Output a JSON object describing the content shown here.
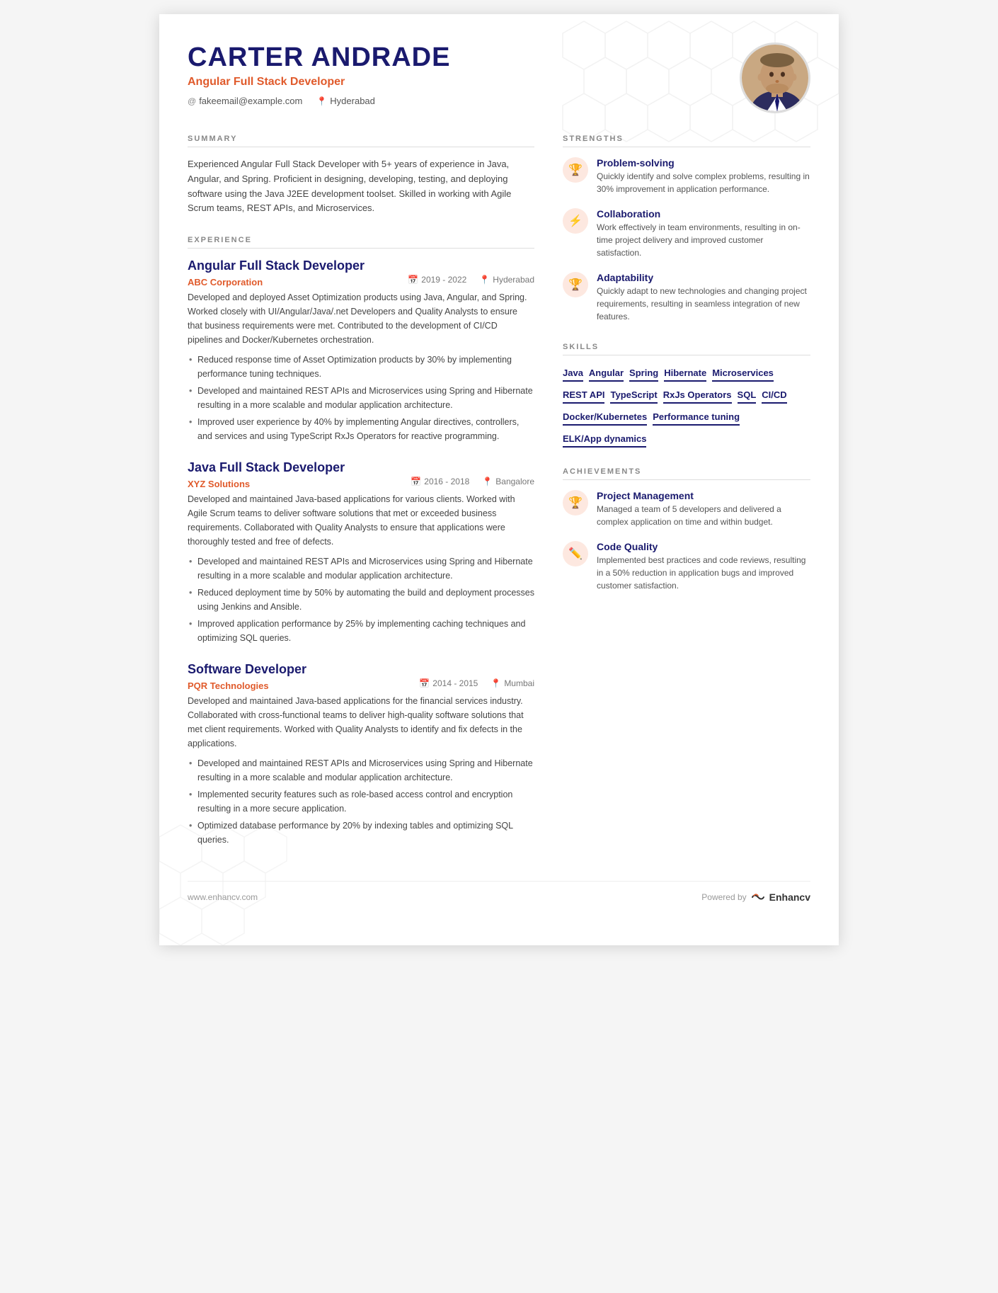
{
  "header": {
    "name": "CARTER ANDRADE",
    "title": "Angular Full Stack Developer",
    "email": "fakeemail@example.com",
    "location": "Hyderabad"
  },
  "summary": {
    "label": "SUMMARY",
    "text": "Experienced Angular Full Stack Developer with 5+ years of experience in Java, Angular, and Spring. Proficient in designing, developing, testing, and deploying software using the Java J2EE development toolset. Skilled in working with Agile Scrum teams, REST APIs, and Microservices."
  },
  "experience": {
    "label": "EXPERIENCE",
    "jobs": [
      {
        "title": "Angular Full Stack Developer",
        "company": "ABC Corporation",
        "period": "2019 - 2022",
        "location": "Hyderabad",
        "description": "Developed and deployed Asset Optimization products using Java, Angular, and Spring. Worked closely with UI/Angular/Java/.net Developers and Quality Analysts to ensure that business requirements were met. Contributed to the development of CI/CD pipelines and Docker/Kubernetes orchestration.",
        "bullets": [
          "Reduced response time of Asset Optimization products by 30% by implementing performance tuning techniques.",
          "Developed and maintained REST APIs and Microservices using Spring and Hibernate resulting in a more scalable and modular application architecture.",
          "Improved user experience by 40% by implementing Angular directives, controllers, and services and using TypeScript RxJs Operators for reactive programming."
        ]
      },
      {
        "title": "Java Full Stack Developer",
        "company": "XYZ Solutions",
        "period": "2016 - 2018",
        "location": "Bangalore",
        "description": "Developed and maintained Java-based applications for various clients. Worked with Agile Scrum teams to deliver software solutions that met or exceeded business requirements. Collaborated with Quality Analysts to ensure that applications were thoroughly tested and free of defects.",
        "bullets": [
          "Developed and maintained REST APIs and Microservices using Spring and Hibernate resulting in a more scalable and modular application architecture.",
          "Reduced deployment time by 50% by automating the build and deployment processes using Jenkins and Ansible.",
          "Improved application performance by 25% by implementing caching techniques and optimizing SQL queries."
        ]
      },
      {
        "title": "Software Developer",
        "company": "PQR Technologies",
        "period": "2014 - 2015",
        "location": "Mumbai",
        "description": "Developed and maintained Java-based applications for the financial services industry. Collaborated with cross-functional teams to deliver high-quality software solutions that met client requirements. Worked with Quality Analysts to identify and fix defects in the applications.",
        "bullets": [
          "Developed and maintained REST APIs and Microservices using Spring and Hibernate resulting in a more scalable and modular application architecture.",
          "Implemented security features such as role-based access control and encryption resulting in a more secure application.",
          "Optimized database performance by 20% by indexing tables and optimizing SQL queries."
        ]
      }
    ]
  },
  "strengths": {
    "label": "STRENGTHS",
    "items": [
      {
        "name": "Problem-solving",
        "desc": "Quickly identify and solve complex problems, resulting in 30% improvement in application performance.",
        "icon": "🏆"
      },
      {
        "name": "Collaboration",
        "desc": "Work effectively in team environments, resulting in on-time project delivery and improved customer satisfaction.",
        "icon": "⚡"
      },
      {
        "name": "Adaptability",
        "desc": "Quickly adapt to new technologies and changing project requirements, resulting in seamless integration of new features.",
        "icon": "🏆"
      }
    ]
  },
  "skills": {
    "label": "SKILLS",
    "items": [
      "Java",
      "Angular",
      "Spring",
      "Hibernate",
      "Microservices",
      "REST API",
      "TypeScript",
      "RxJs Operators",
      "SQL",
      "CI/CD",
      "Docker/Kubernetes",
      "Performance tuning",
      "ELK/App dynamics"
    ]
  },
  "achievements": {
    "label": "ACHIEVEMENTS",
    "items": [
      {
        "name": "Project Management",
        "desc": "Managed a team of 5 developers and delivered a complex application on time and within budget.",
        "icon": "🏆"
      },
      {
        "name": "Code Quality",
        "desc": "Implemented best practices and code reviews, resulting in a 50% reduction in application bugs and improved customer satisfaction.",
        "icon": "✏️"
      }
    ]
  },
  "footer": {
    "website": "www.enhancv.com",
    "powered_by": "Powered by",
    "brand": "Enhancv"
  }
}
